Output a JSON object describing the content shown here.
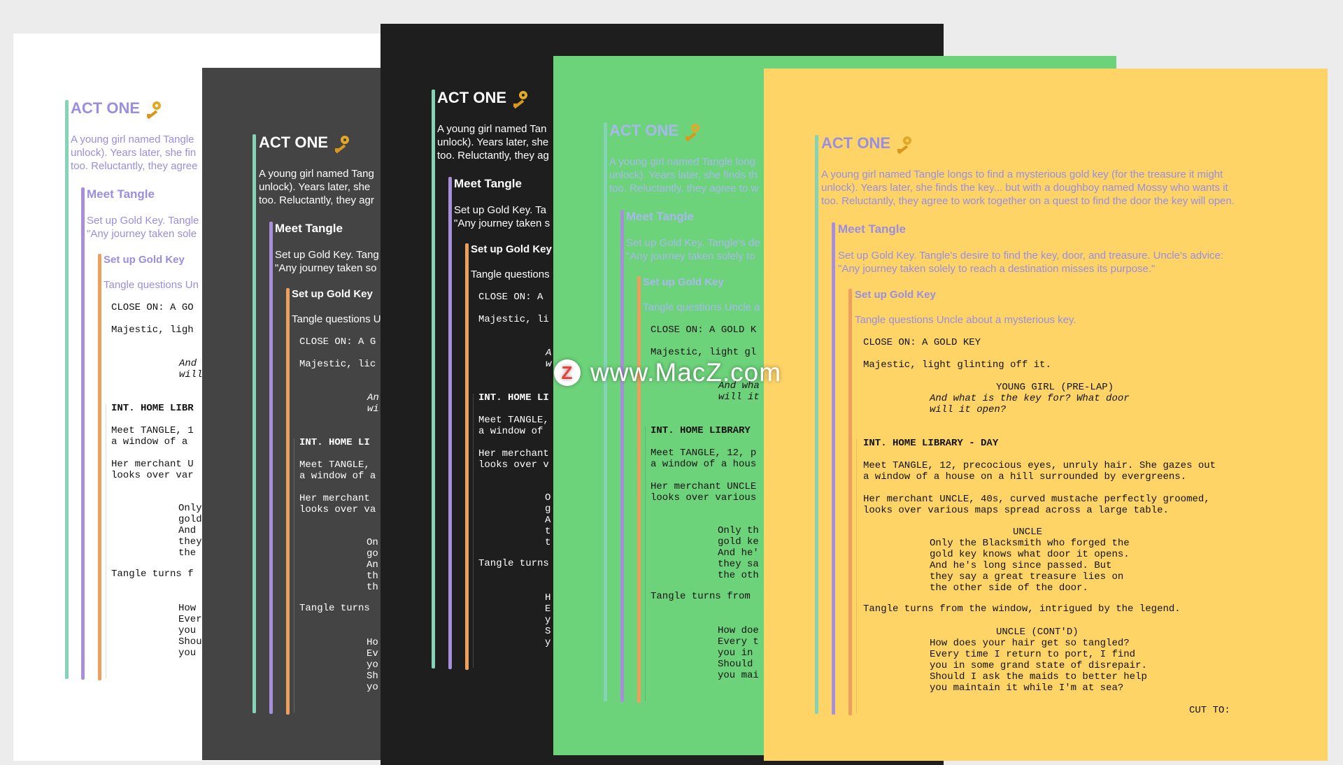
{
  "watermark": {
    "text": "www.MacZ.com",
    "logo_letter": "Z"
  },
  "colors": {
    "white_sheet": "#ffffff",
    "gray_sheet": "#444444",
    "black_sheet": "#1e1e1e",
    "green_sheet": "#6dd37a",
    "yellow_sheet": "#fdd465",
    "act_bar": "#84d3b6",
    "sequence_bar": "#a78fdc",
    "scene_bar": "#ee9f5e",
    "outline_text": "#8b80d8",
    "key_icon": "#e2a928"
  },
  "themes": [
    {
      "name": "white",
      "clip_act_summary": [
        "A young girl named Tangle",
        "unlock). Years later, she fin",
        "too. Reluctantly, they agree"
      ],
      "clip_seq_summary": [
        "Set up Gold Key. Tangle",
        "\"Any journey taken sole"
      ],
      "clip_scene_summary": "Tangle questions Un",
      "clip_close_on": "CLOSE ON: A GO",
      "clip_majestic": "Majestic, ligh",
      "clip_dialogue1": [
        "And",
        "will"
      ],
      "clip_slug": "INT. HOME LIBR",
      "clip_meet": [
        "Meet TANGLE, 1",
        "a window of a"
      ],
      "clip_merchant": [
        "Her merchant U",
        "looks over var"
      ],
      "clip_uncle_lines": [
        "Only",
        "gold",
        "And",
        "they",
        "the"
      ],
      "clip_turns": "Tangle turns f",
      "clip_final": [
        "How",
        "Ever",
        "you",
        "Shou",
        "you"
      ]
    },
    {
      "name": "gray",
      "clip_act_summary": [
        "A young girl named Tang",
        "unlock). Years later, she",
        "too. Reluctantly, they agr"
      ],
      "clip_seq_summary": [
        "Set up Gold Key. Tang",
        "\"Any journey taken so"
      ],
      "clip_scene_summary": "Tangle questions U",
      "clip_close_on": "CLOSE ON: A G",
      "clip_majestic": "Majestic, lic",
      "clip_dialogue1": [
        "An",
        "wi"
      ],
      "clip_slug": "INT. HOME LI",
      "clip_meet": [
        "Meet TANGLE,",
        "a window of a"
      ],
      "clip_merchant": [
        "Her merchant",
        "looks over va"
      ],
      "clip_uncle_lines": [
        "On",
        "go",
        "An",
        "th",
        "th"
      ],
      "clip_turns": "Tangle turns",
      "clip_final": [
        "Ho",
        "Ev",
        "yo",
        "Sh",
        "yo"
      ]
    },
    {
      "name": "black",
      "clip_act_summary": [
        "A young girl named Tan",
        "unlock). Years later, she",
        "too. Reluctantly, they ag"
      ],
      "clip_seq_summary": [
        "Set up Gold Key. Ta",
        "\"Any journey taken s"
      ],
      "clip_scene_summary": "Tangle questions",
      "clip_close_on": "CLOSE ON: A",
      "clip_majestic": "Majestic, li",
      "clip_dialogue1": [
        "A",
        "w"
      ],
      "clip_slug": "INT. HOME LI",
      "clip_meet": [
        "Meet TANGLE,",
        "a window of"
      ],
      "clip_merchant": [
        "Her merchant",
        "looks over v"
      ],
      "clip_uncle_lines": [
        "O",
        "g",
        "A",
        "t",
        "t"
      ],
      "clip_turns": "Tangle turns",
      "clip_final": [
        "H",
        "E",
        "y",
        "S",
        "y"
      ]
    },
    {
      "name": "green",
      "clip_act_summary": [
        "A young girl named Tangle long",
        "unlock). Years later, she finds th",
        "too. Reluctantly, they agree to w"
      ],
      "clip_seq_summary": [
        "Set up Gold Key. Tangle's de",
        "\"Any journey taken solely to"
      ],
      "clip_scene_summary": "Tangle questions Uncle a",
      "clip_close_on": "CLOSE ON: A GOLD K",
      "clip_majestic": "Majestic, light gl",
      "clip_dialogue1": [
        "And wha",
        "will it"
      ],
      "clip_slug": "INT. HOME LIBRARY",
      "clip_meet": [
        "Meet TANGLE, 12, p",
        "a window of a hous"
      ],
      "clip_merchant": [
        "Her merchant UNCLE",
        "looks over various"
      ],
      "clip_uncle_lines": [
        "Only th",
        "gold ke",
        "And he'",
        "they sa",
        "the oth"
      ],
      "clip_turns": "Tangle turns from",
      "clip_final": [
        "How doe",
        "Every t",
        "you in",
        "Should",
        "you mai"
      ]
    }
  ],
  "script": {
    "act_title": "ACT ONE",
    "act_summary": [
      "A young girl named Tangle longs to find a mysterious gold key (for the treasure it might",
      "unlock). Years later, she finds the key... but with a doughboy named Mossy who wants it",
      "too. Reluctantly, they agree to work together on a quest to find the door the key will open."
    ],
    "sequence_title": "Meet Tangle",
    "sequence_summary": [
      "Set up Gold Key. Tangle's desire to find the key, door, and treasure. Uncle's advice:",
      "\"Any journey taken solely to reach a destination misses its purpose.\""
    ],
    "scene_title": "Set up Gold Key",
    "scene_summary": "Tangle questions Uncle about a mysterious key.",
    "close_on": "CLOSE ON: A GOLD KEY",
    "majestic": "Majestic, light glinting off it.",
    "young_girl_cue": "YOUNG GIRL (PRE-LAP)",
    "young_girl_lines": [
      "And what is the key for? What door",
      "will it open?"
    ],
    "slugline": "INT. HOME LIBRARY - DAY",
    "meet_tangle_action": [
      "Meet TANGLE, 12, precocious eyes, unruly hair. She gazes out",
      "a window of a house on a hill surrounded by evergreens."
    ],
    "merchant_action": [
      "Her merchant UNCLE, 40s, curved mustache perfectly groomed,",
      "looks over various maps spread across a large table."
    ],
    "uncle_cue": "UNCLE",
    "uncle_lines": [
      "Only the Blacksmith who forged the",
      "gold key knows what door it opens.",
      "And he's long since passed. But",
      "they say a great treasure lies on",
      "the other side of the door."
    ],
    "turns_action": "Tangle turns from the window, intrigued by the legend.",
    "uncle_contd_cue": "UNCLE (CONT'D)",
    "uncle_contd_lines": [
      "How does your hair get so tangled?",
      "Every time I return to port, I find",
      "you in some grand state of disrepair.",
      "Should I ask the maids to better help",
      "you maintain it while I'm at sea?"
    ],
    "transition": "CUT TO:"
  }
}
